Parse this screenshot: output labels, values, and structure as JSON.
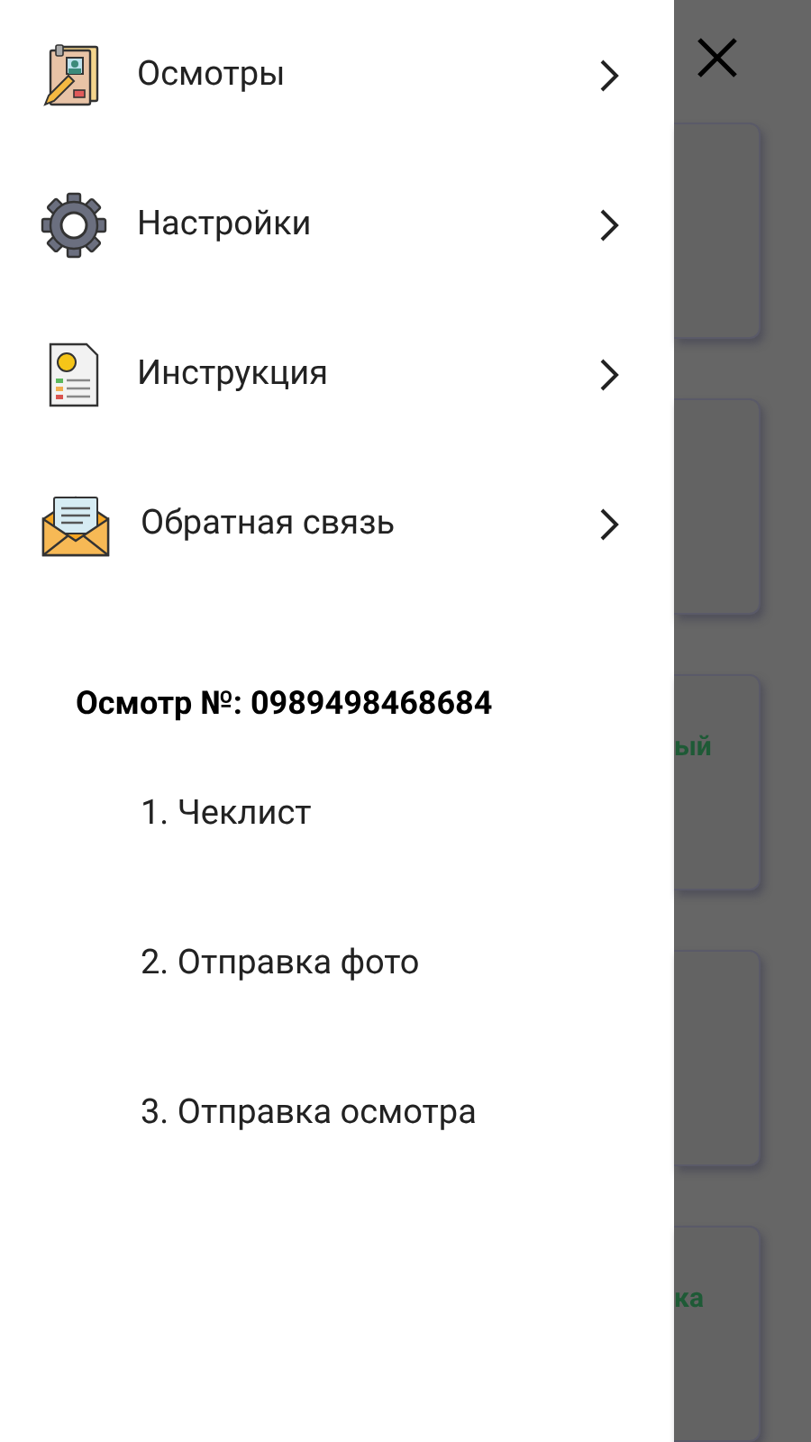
{
  "menu": [
    {
      "kind": "inspections",
      "label": "Осмотры"
    },
    {
      "kind": "settings",
      "label": "Настройки"
    },
    {
      "kind": "manual",
      "label": "Инструкция"
    },
    {
      "kind": "feedback",
      "label": "Обратная связь"
    }
  ],
  "inspection": {
    "title": "Осмотр №: 0989498468684",
    "steps": [
      "1. Чеклист",
      "2. Отправка фото",
      "3. Отправка осмотра"
    ]
  },
  "background_cards": [
    {
      "kind": "plain"
    },
    {
      "kind": "plain"
    },
    {
      "kind": "titled",
      "text": "ый"
    },
    {
      "kind": "plain"
    },
    {
      "kind": "titled",
      "text": "ка"
    }
  ]
}
